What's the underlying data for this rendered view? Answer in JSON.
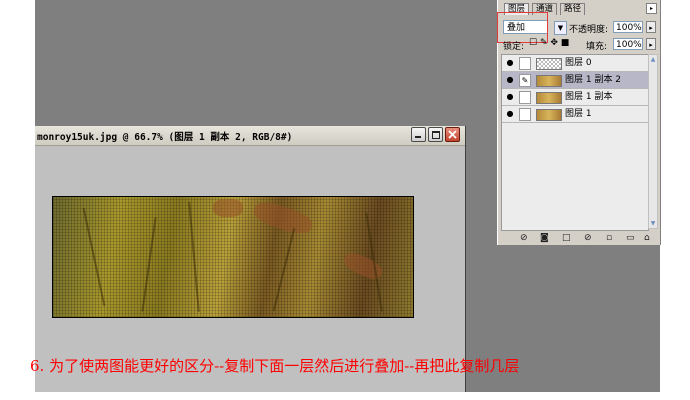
{
  "document": {
    "title": "monroy15uk.jpg @ 66.7% (图层 1 副本 2, RGB/8#)"
  },
  "caption": "6. 为了使两图能更好的区分--复制下面一层然后进行叠加--再把此复制几层",
  "layers_panel": {
    "tabs": [
      "图层",
      "通道",
      "路径"
    ],
    "blend_mode": "叠加",
    "opacity_label": "不透明度:",
    "opacity_value": "100%",
    "lock_label": "锁定:",
    "fill_label": "填充:",
    "fill_value": "100%",
    "layers": [
      {
        "name": "图层 0",
        "selected": false,
        "thumbnail": "transparent-checker"
      },
      {
        "name": "图层 1 副本 2",
        "selected": true,
        "thumbnail": "image"
      },
      {
        "name": "图层 1 副本",
        "selected": false,
        "thumbnail": "image"
      },
      {
        "name": "图层 1",
        "selected": false,
        "thumbnail": "image"
      }
    ],
    "bottom_icons": [
      "link-layers-icon",
      "add-style-icon",
      "add-mask-icon",
      "new-adjustment-icon",
      "new-group-icon",
      "new-layer-icon",
      "trash-icon"
    ]
  },
  "colors": {
    "workspace": "#7f7f7f",
    "caption": "#ff0000",
    "selected_layer": "#b8b7c7"
  }
}
